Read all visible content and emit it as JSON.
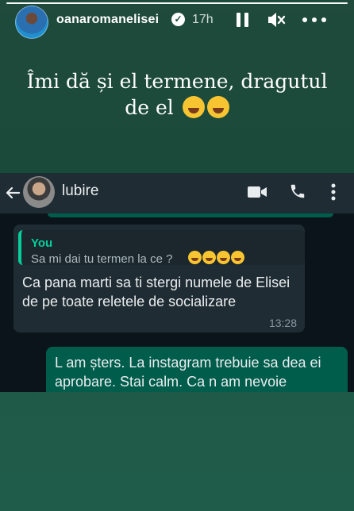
{
  "story": {
    "username": "oanaromanelisei",
    "verified_glyph": "✓",
    "time": "17h",
    "progress": 1.0,
    "icons": [
      "verified-icon",
      "pause-icon",
      "mute-icon",
      "more-icon"
    ],
    "caption_line1": "Îmi dă și el termene, dragutul",
    "caption_line2": "de el",
    "caption_emoji": "rolling-on-floor-laughing",
    "caption_emoji_count": 2
  },
  "whatsapp": {
    "contact_name": "lubire",
    "icons": [
      "back-arrow-icon",
      "video-call-icon",
      "phone-icon",
      "more-vertical-icon"
    ],
    "quoted": {
      "author": "You",
      "text": "Sa mi dai tu termen la ce ?",
      "emoji": "rolling-on-floor-laughing",
      "emoji_count": 4
    },
    "incoming": {
      "text": "Ca pana marti sa ti stergi numele de Elisei de pe toate reletele de socializare",
      "time": "13:28"
    },
    "outgoing": {
      "text": "L am șters. La instagram trebuie sa dea ei aprobare. Stai calm. Ca n am nevoie"
    }
  },
  "colors": {
    "story_bg": "#1f4a3c",
    "wa_header": "#1f2c34",
    "wa_chat_bg": "#0b141a",
    "incoming_bubble": "#202c33",
    "outgoing_bubble": "#005c4b",
    "quote_accent": "#06cf9c"
  }
}
